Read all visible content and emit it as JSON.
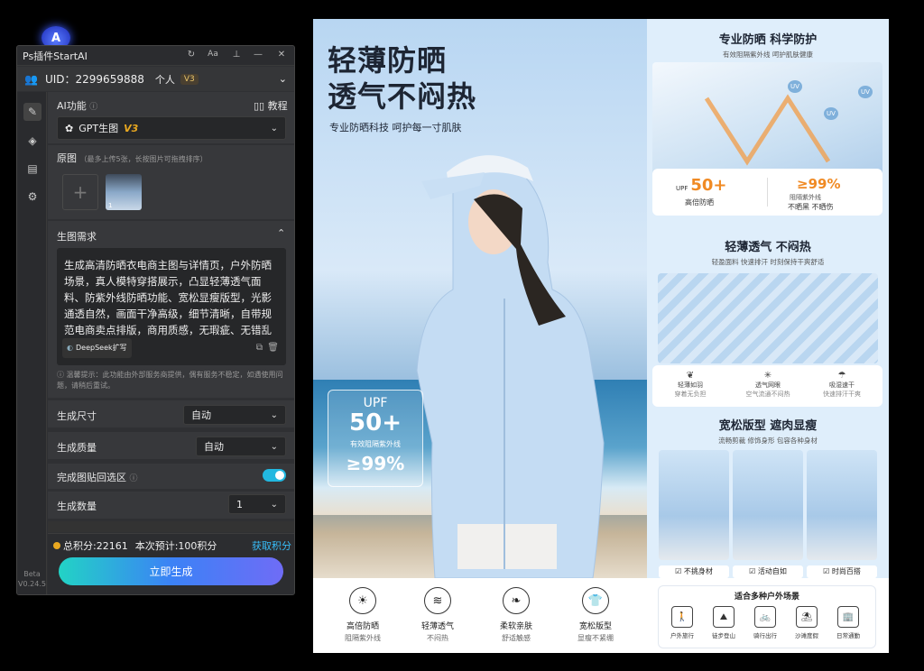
{
  "panel": {
    "title": "Ps插件StartAI",
    "uid": "UID：2299659888",
    "account": "个人",
    "account_badge": "V3",
    "ai_label": "AI功能",
    "tutorial": "教程",
    "model": "GPT生图",
    "model_badge": "V3",
    "source_label": "原图",
    "source_hint": "（最多上传5张，长按图片可拖拽排序）",
    "thumb_index": "1",
    "prompt_label": "生图需求",
    "prompt_text": "生成高清防晒衣电商主图与详情页，户外防晒场景，真人模特穿搭展示，凸显轻薄透气面料、防紫外线防晒功能、宽松显瘦版型，光影通透自然，画面干净高级，细节清晰，自带规范电商卖点排版，商用质感，无瑕疵、无错乱元素。",
    "deepseek": "DeepSeek扩写",
    "notice": "温馨提示：此功能由外部服务商提供，偶有服务不稳定，如遇使用问题，请稍后重试。",
    "size_label": "生成尺寸",
    "size_value": "自动",
    "quality_label": "生成质量",
    "quality_value": "自动",
    "paste_label": "完成图贴回选区",
    "count_label": "生成数量",
    "count_value": "1",
    "points": "总积分:22161",
    "estimate": "本次预计:100积分",
    "get_points": "获取积分",
    "generate": "立即生成",
    "version1": "Beta",
    "version2": "V0.24.5"
  },
  "poster": {
    "hero_title1": "轻薄防晒",
    "hero_title2": "透气不闷热",
    "hero_sub": "专业防晒科技 呵护每一寸肌肤",
    "upf": "UPF",
    "upf_value": "50+",
    "upf_text": "有效阻隔紫外线",
    "upf_pct": "≥99%",
    "r1_title": "专业防晒 科学防护",
    "r1_sub": "有效阻隔紫外线 呵护肌肤健康",
    "r1_upf": "UPF",
    "r1_upf_val": "50+",
    "r1_upf_t": "高倍防晒",
    "r1_pct": "≥99%",
    "r1_pct_t1": "阻隔紫外线",
    "r1_pct_t2": "不晒黑 不晒伤",
    "r2_title": "轻薄透气 不闷热",
    "r2_sub": "轻盈面料 快速排汗 时刻保持干爽舒适",
    "r2_f1": "轻薄如羽",
    "r2_f1s": "穿着无负担",
    "r2_f2": "透气网眼",
    "r2_f2s": "空气流通不闷热",
    "r2_f3": "吸湿速干",
    "r2_f3s": "快速排汗干爽",
    "r3_title": "宽松版型 遮肉显瘦",
    "r3_sub": "流畅剪裁 修饰身形 包容各种身材",
    "r3_c1": "不挑身材",
    "r3_c2": "活动自如",
    "r3_c3": "时尚百搭",
    "scenes_title": "适合多种户外场景",
    "scenes": [
      "户外旅行",
      "徒步登山",
      "骑行出行",
      "沙滩度假",
      "日常通勤"
    ],
    "features": [
      {
        "t": "高倍防晒",
        "s": "阻隔紫外线",
        "icon": "sun-icon"
      },
      {
        "t": "轻薄透气",
        "s": "不闷热",
        "icon": "airflow-icon"
      },
      {
        "t": "柔软亲肤",
        "s": "舒适触感",
        "icon": "leaf-icon"
      },
      {
        "t": "宽松版型",
        "s": "显瘦不紧绷",
        "icon": "tshirt-icon"
      }
    ],
    "uv_labels": [
      "UV",
      "UV",
      "UV"
    ]
  },
  "colors": {
    "accent": "#3b82f6",
    "toggle": "#22b8e0",
    "gold": "#e9a820",
    "orange": "#f08a24"
  }
}
